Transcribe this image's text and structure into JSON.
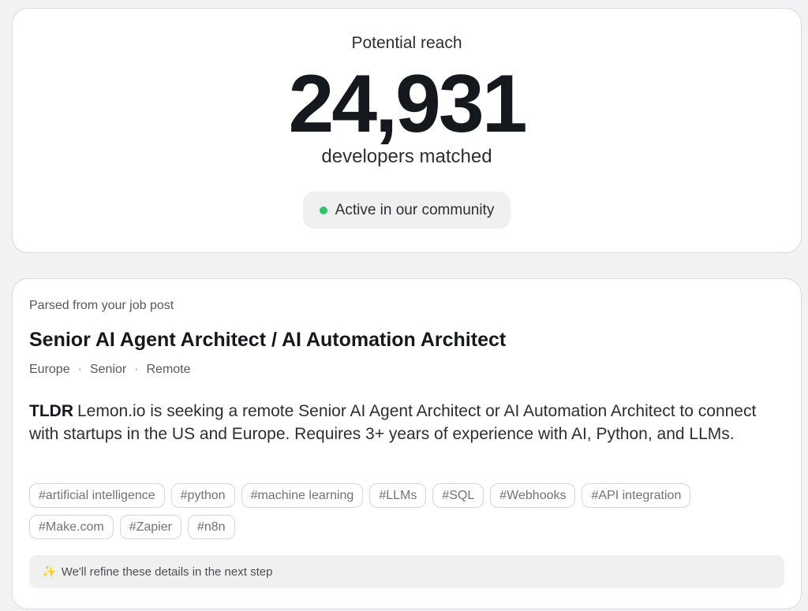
{
  "reach": {
    "label": "Potential reach",
    "count": "24,931",
    "sub": "developers matched",
    "status": "Active in our community",
    "status_color": "#2ec46a"
  },
  "job": {
    "parsed_label": "Parsed from your job post",
    "title": "Senior AI Agent Architect / AI Automation Architect",
    "meta": [
      "Europe",
      "Senior",
      "Remote"
    ],
    "meta_separator": "·",
    "tldr_label": "TLDR",
    "tldr_text": "Lemon.io is seeking a remote Senior AI Agent Architect or AI Automation Architect to connect with startups in the US and Europe. Requires 3+ years of experience with AI, Python, and LLMs.",
    "tags": [
      "#artificial intelligence",
      "#python",
      "#machine learning",
      "#LLMs",
      "#SQL",
      "#Webhooks",
      "#API integration",
      "#Make.com",
      "#Zapier",
      "#n8n"
    ],
    "note_icon": "sparkles-icon",
    "note": "We'll refine these details in the next step"
  }
}
